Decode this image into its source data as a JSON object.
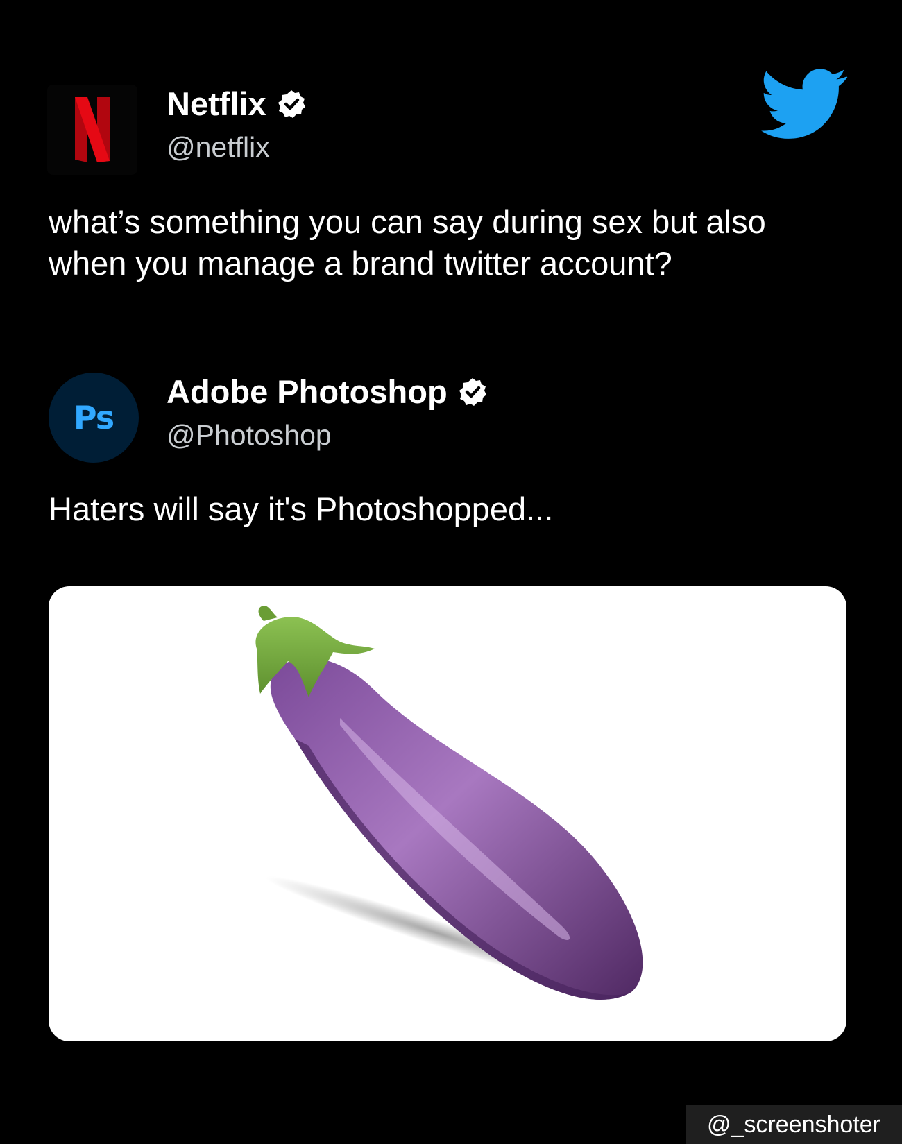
{
  "tweet1": {
    "display_name": "Netflix",
    "handle": "@netflix",
    "text_line1": "what’s something you can say during sex but also",
    "text_line2": "when you manage a brand twitter account?",
    "avatar_letter": "N",
    "avatar_color": "#e50914",
    "verified": true
  },
  "tweet2": {
    "display_name": "Adobe Photoshop",
    "handle": "@Photoshop",
    "text": "Haters will say it's Photoshopped...",
    "avatar_text": "Ps",
    "avatar_color": "#001e36",
    "avatar_text_color": "#31a8ff",
    "verified": true,
    "media": {
      "icon": "eggplant-icon",
      "background": "#ffffff"
    }
  },
  "icons": {
    "twitter_logo": "twitter-bird-icon",
    "verified_badge": "verified-badge-icon"
  },
  "colors": {
    "background": "#000000",
    "twitter_blue": "#1da1f2",
    "handle_gray": "#c9cdd1"
  },
  "watermark": "@_screenshoter"
}
